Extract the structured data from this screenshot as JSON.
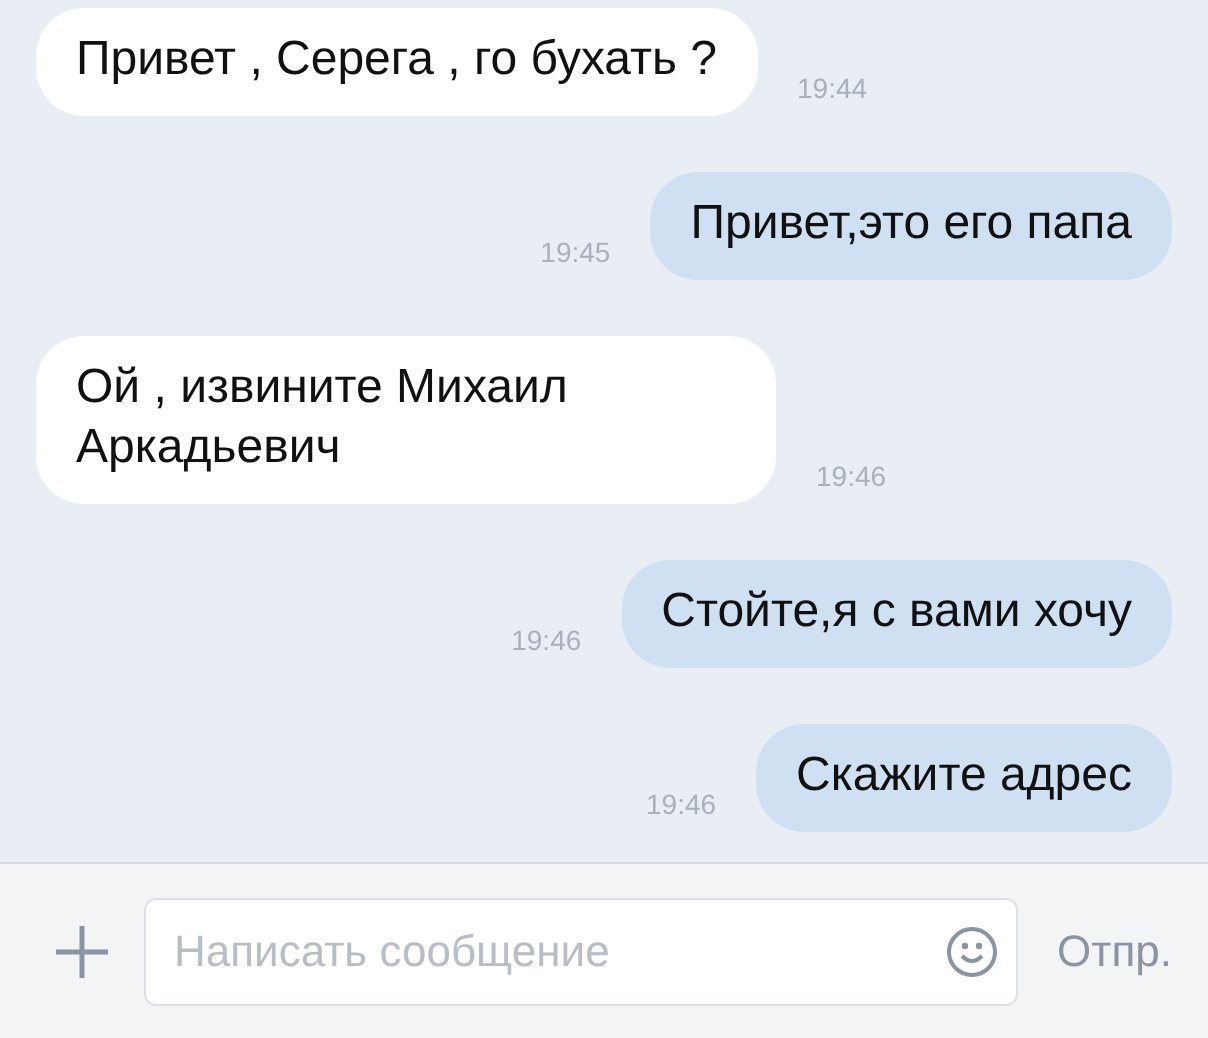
{
  "messages": [
    {
      "kind": "incoming",
      "text": "Привет , Серега , го бухать ?",
      "time": "19:44"
    },
    {
      "kind": "outgoing",
      "text": "Привет,это его папа",
      "time": "19:45"
    },
    {
      "kind": "incoming",
      "text": "Ой , извините Михаил Аркадьевич",
      "time": "19:46"
    },
    {
      "kind": "outgoing",
      "text": "Стойте,я с вами хочу",
      "time": "19:46"
    },
    {
      "kind": "outgoing",
      "text": "Скажите адрес",
      "time": "19:46"
    }
  ],
  "composer": {
    "placeholder": "Написать сообщение",
    "send": "Отпр."
  }
}
